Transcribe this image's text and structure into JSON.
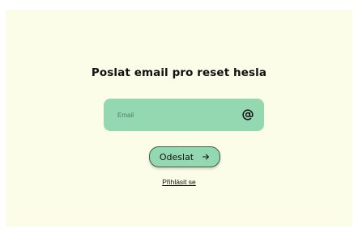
{
  "form": {
    "title": "Poslat email pro reset hesla",
    "email": {
      "placeholder": "Email",
      "value": "",
      "icon": "at-icon"
    },
    "submit": {
      "label": "Odeslat",
      "icon": "arrow-right-icon"
    },
    "login_link": "Přihlásit se"
  },
  "colors": {
    "background": "#fcfde8",
    "accent": "#93d8b1",
    "button_border": "#3f5d4c",
    "text": "#111111"
  }
}
